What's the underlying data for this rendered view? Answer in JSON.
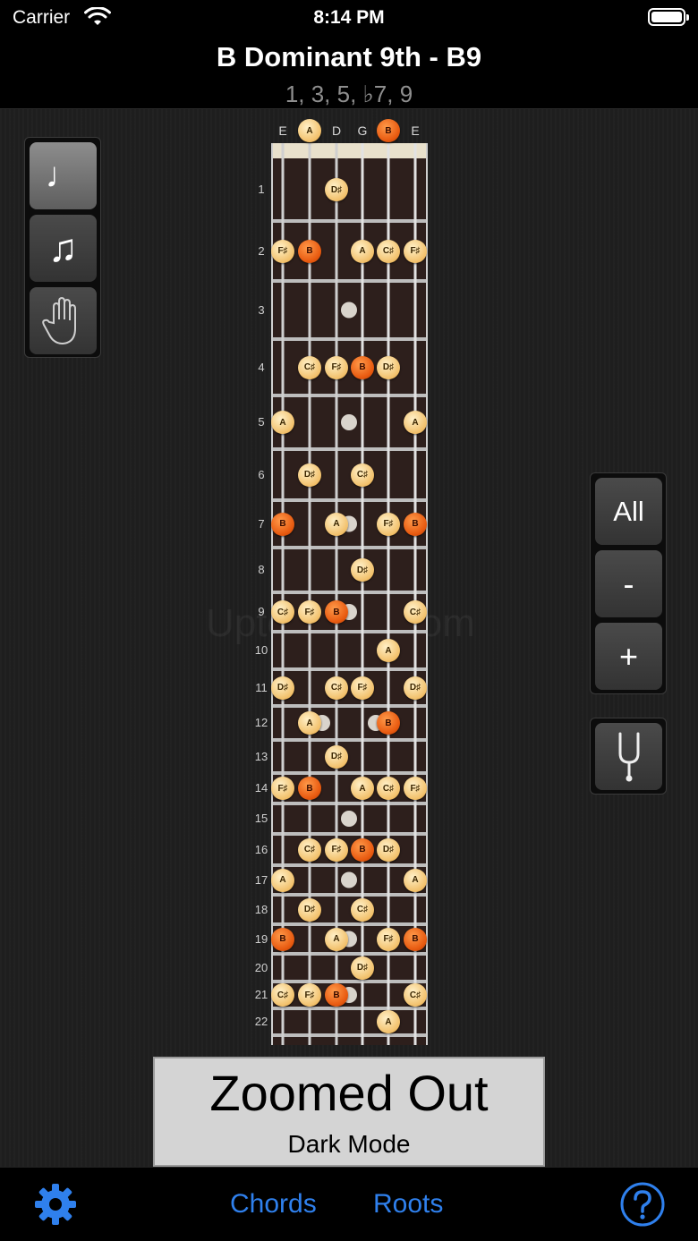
{
  "status": {
    "carrier": "Carrier",
    "time": "8:14 PM"
  },
  "header": {
    "title": "B Dominant 9th - B9",
    "formula": "1, 3, 5, ♭7, 9"
  },
  "left_tools": [
    {
      "name": "single-note",
      "icon": "quarter-note-icon",
      "glyph": "♩",
      "active": true
    },
    {
      "name": "double-note",
      "icon": "beamed-notes-icon",
      "glyph": "♫",
      "active": false
    },
    {
      "name": "hand",
      "icon": "hand-icon",
      "glyph": "",
      "active": false
    }
  ],
  "right_zoom": {
    "all": "All",
    "minus": "-",
    "plus": "+"
  },
  "tuner": {
    "icon": "tuning-fork-icon"
  },
  "fretboard": {
    "strings": [
      "E",
      "A",
      "D",
      "G",
      "B",
      "E"
    ],
    "open_notes": [
      {
        "s": 1,
        "n": "A",
        "root": false
      },
      {
        "s": 4,
        "n": "B",
        "root": true
      }
    ],
    "frets": [
      "1",
      "2",
      "3",
      "4",
      "5",
      "6",
      "7",
      "8",
      "9",
      "10",
      "11",
      "12",
      "13",
      "14",
      "15",
      "16",
      "17",
      "18",
      "19",
      "20",
      "21",
      "22"
    ],
    "inlays": [
      3,
      5,
      7,
      9,
      15,
      17,
      19,
      21
    ],
    "double_inlays": [
      12
    ],
    "notes": [
      {
        "f": 1,
        "s": 2,
        "n": "D♯"
      },
      {
        "f": 2,
        "s": 0,
        "n": "F♯"
      },
      {
        "f": 2,
        "s": 1,
        "n": "B",
        "root": true
      },
      {
        "f": 2,
        "s": 3,
        "n": "A"
      },
      {
        "f": 2,
        "s": 4,
        "n": "C♯"
      },
      {
        "f": 2,
        "s": 5,
        "n": "F♯"
      },
      {
        "f": 4,
        "s": 1,
        "n": "C♯"
      },
      {
        "f": 4,
        "s": 2,
        "n": "F♯"
      },
      {
        "f": 4,
        "s": 3,
        "n": "B",
        "root": true
      },
      {
        "f": 4,
        "s": 4,
        "n": "D♯"
      },
      {
        "f": 5,
        "s": 0,
        "n": "A"
      },
      {
        "f": 5,
        "s": 5,
        "n": "A"
      },
      {
        "f": 6,
        "s": 1,
        "n": "D♯"
      },
      {
        "f": 6,
        "s": 3,
        "n": "C♯"
      },
      {
        "f": 7,
        "s": 0,
        "n": "B",
        "root": true
      },
      {
        "f": 7,
        "s": 2,
        "n": "A"
      },
      {
        "f": 7,
        "s": 4,
        "n": "F♯"
      },
      {
        "f": 7,
        "s": 5,
        "n": "B",
        "root": true
      },
      {
        "f": 8,
        "s": 3,
        "n": "D♯"
      },
      {
        "f": 9,
        "s": 0,
        "n": "C♯"
      },
      {
        "f": 9,
        "s": 1,
        "n": "F♯"
      },
      {
        "f": 9,
        "s": 2,
        "n": "B",
        "root": true
      },
      {
        "f": 9,
        "s": 5,
        "n": "C♯"
      },
      {
        "f": 10,
        "s": 4,
        "n": "A"
      },
      {
        "f": 11,
        "s": 0,
        "n": "D♯"
      },
      {
        "f": 11,
        "s": 2,
        "n": "C♯"
      },
      {
        "f": 11,
        "s": 3,
        "n": "F♯"
      },
      {
        "f": 11,
        "s": 5,
        "n": "D♯"
      },
      {
        "f": 12,
        "s": 1,
        "n": "A"
      },
      {
        "f": 12,
        "s": 4,
        "n": "B",
        "root": true
      },
      {
        "f": 13,
        "s": 2,
        "n": "D♯"
      },
      {
        "f": 14,
        "s": 0,
        "n": "F♯"
      },
      {
        "f": 14,
        "s": 1,
        "n": "B",
        "root": true
      },
      {
        "f": 14,
        "s": 3,
        "n": "A"
      },
      {
        "f": 14,
        "s": 4,
        "n": "C♯"
      },
      {
        "f": 14,
        "s": 5,
        "n": "F♯"
      },
      {
        "f": 16,
        "s": 1,
        "n": "C♯"
      },
      {
        "f": 16,
        "s": 2,
        "n": "F♯"
      },
      {
        "f": 16,
        "s": 3,
        "n": "B",
        "root": true
      },
      {
        "f": 16,
        "s": 4,
        "n": "D♯"
      },
      {
        "f": 17,
        "s": 0,
        "n": "A"
      },
      {
        "f": 17,
        "s": 5,
        "n": "A"
      },
      {
        "f": 18,
        "s": 1,
        "n": "D♯"
      },
      {
        "f": 18,
        "s": 3,
        "n": "C♯"
      },
      {
        "f": 19,
        "s": 0,
        "n": "B",
        "root": true
      },
      {
        "f": 19,
        "s": 2,
        "n": "A"
      },
      {
        "f": 19,
        "s": 4,
        "n": "F♯"
      },
      {
        "f": 19,
        "s": 5,
        "n": "B",
        "root": true
      },
      {
        "f": 20,
        "s": 3,
        "n": "D♯"
      },
      {
        "f": 21,
        "s": 0,
        "n": "C♯"
      },
      {
        "f": 21,
        "s": 1,
        "n": "F♯"
      },
      {
        "f": 21,
        "s": 2,
        "n": "B",
        "root": true
      },
      {
        "f": 21,
        "s": 5,
        "n": "C♯"
      },
      {
        "f": 22,
        "s": 4,
        "n": "A"
      }
    ]
  },
  "zoom_banner": {
    "title": "Zoomed Out",
    "subtitle": "Dark Mode"
  },
  "watermark": "UptoDown.com",
  "tabs": {
    "settings_icon": "gear-icon",
    "chords": "Chords",
    "roots": "Roots",
    "help_icon": "question-circle-icon"
  },
  "colors": {
    "accent": "#2f80ed",
    "note": "#f2c06a",
    "root": "#e85a10",
    "board": "#2d1f1c"
  }
}
